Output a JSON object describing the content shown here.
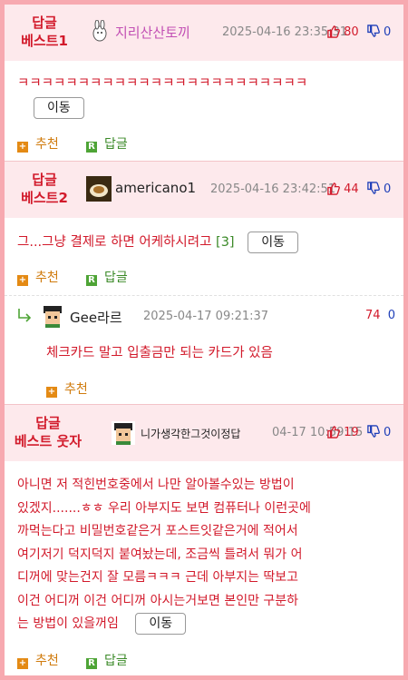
{
  "comments": [
    {
      "badge_line1": "답글",
      "badge_line2": "베스트1",
      "nickname": "지리산산토끼",
      "date": "2025-04-16 23:35:31",
      "up": "80",
      "down": "0",
      "text": "ㅋㅋㅋㅋㅋㅋㅋㅋㅋㅋㅋㅋㅋㅋㅋㅋㅋㅋㅋㅋㅋㅋㅋㅋ",
      "move_label": "이동",
      "recommend_label": "추천",
      "reply_label": "답글"
    },
    {
      "badge_line1": "답글",
      "badge_line2": "베스트2",
      "nickname": "americano1",
      "date": "2025-04-16 23:42:51",
      "up": "44",
      "down": "0",
      "text": "그...그냥 결제로 하면 어케하시려고",
      "reply_count": "[3]",
      "move_label": "이동",
      "recommend_label": "추천",
      "reply_label": "답글"
    },
    {
      "nickname": "Gee라르",
      "date": "2025-04-17 09:21:37",
      "up": "74",
      "down": "0",
      "text": "체크카드 말고 입출금만 되는 카드가 있음",
      "recommend_label": "추천"
    },
    {
      "badge_line1": "답글",
      "badge_line2": "베스트 웃자",
      "nickname": "니가생각한그것이정답",
      "date": "04-17 10:59:15",
      "up": "19",
      "down": "0",
      "text_lines": [
        "아니면 저 적힌번호중에서 나만 알아볼수있는 방법이",
        "있겠지.......ㅎㅎ 우리 아부지도 보면 컴퓨터나 이런곳에",
        "까먹는다고 비밀번호같은거 포스트잇같은거에 적어서",
        "여기저기 덕지덕지 붙여놨는데, 조금씩 틀려서 뭐가 어",
        "디꺼에 맞는건지 잘 모름ㅋㅋㅋ 근데 아부지는 딱보고",
        "이건 어디꺼 이건 어디꺼 아시는거보면 본인만 구분하",
        "는 방법이 있을꺼임"
      ],
      "move_label": "이동",
      "recommend_label": "추천",
      "reply_label": "답글"
    }
  ],
  "colors": {
    "accent_red": "#d21a2b",
    "down_blue": "#1f3fb8",
    "header_bg": "#fde9ec",
    "frame_pink": "#f7a9b0"
  }
}
